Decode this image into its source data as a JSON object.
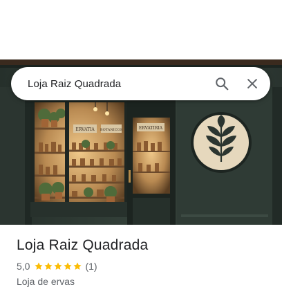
{
  "search": {
    "query": "Loja Raiz Quadrada",
    "search_icon": "search-icon",
    "close_icon": "close-icon"
  },
  "hero": {
    "description_icons": [
      "leaf-logo-icon"
    ],
    "shop_signs": [
      "ERVATIA",
      "BOTANICOS",
      "ERVATIRIA"
    ]
  },
  "place": {
    "name": "Loja Raiz Quadrada",
    "rating": "5,0",
    "stars": 5,
    "review_count": "(1)",
    "category": "Loja de ervas"
  },
  "colors": {
    "star": "#fbbc04",
    "storefront": "#2f3b34",
    "accent_text": "#5f6368"
  }
}
